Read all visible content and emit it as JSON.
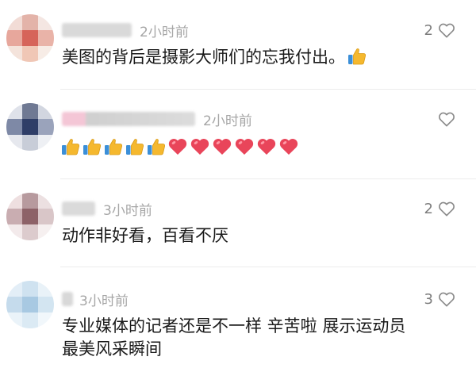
{
  "comments": [
    {
      "time": "2小时前",
      "likes": "2",
      "text": "美图的背后是摄影大师们的忘我付出。",
      "emoji": [
        "thumbs-up"
      ]
    },
    {
      "time": "2小时前",
      "likes": "",
      "text": "",
      "emoji": [
        "thumbs-up",
        "thumbs-up",
        "thumbs-up",
        "thumbs-up",
        "thumbs-up",
        "red-heart",
        "red-heart",
        "red-heart",
        "red-heart",
        "red-heart",
        "red-heart"
      ]
    },
    {
      "time": "3小时前",
      "likes": "2",
      "text": "动作非好看，百看不厌",
      "emoji": []
    },
    {
      "time": "3小时前",
      "likes": "3",
      "text_line1": "专业媒体的记者还是不一样 辛苦啦 展示运动员",
      "text_line2": "最美风采瞬间",
      "emoji": []
    }
  ],
  "colors": {
    "time": "#a6a6a6",
    "count": "#7d7d7d",
    "text": "#1a1a1a",
    "heart_outline": "#8a8a8a",
    "red_heart": "#e9455a",
    "thumb": "#f5b82e"
  },
  "icons": {
    "like": "heart-outline-icon",
    "thumb": "thumbs-up-icon",
    "heart": "red-heart-icon"
  }
}
